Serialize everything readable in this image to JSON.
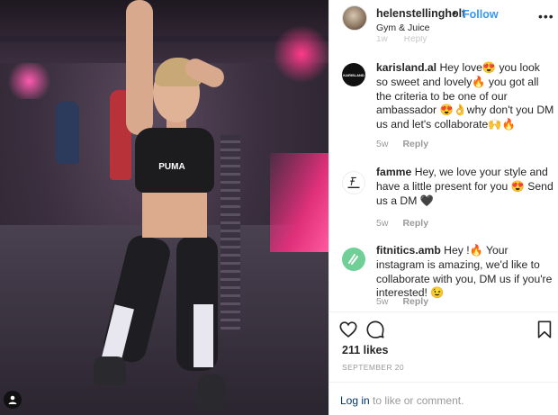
{
  "post": {
    "username": "helenstellingholt",
    "separator": "•",
    "follow_label": "Follow",
    "location": "Gym & Juice",
    "more_label": "•••",
    "photo_logo": "PUMA"
  },
  "peek": {
    "age": "1w",
    "reply": "Reply"
  },
  "comments": [
    {
      "username": "karisland.al",
      "avatar_text": "KARISLAND",
      "text": "Hey love😍 you look so sweet and lovely🔥 you got all the criteria to be one of our ambassador 😍👌why don't you DM us and let's collaborate🙌🔥",
      "age": "5w",
      "reply": "Reply"
    },
    {
      "username": "famme",
      "avatar_text": "FAMME",
      "text": "Hey, we love your style and have a little present for you 😍 Send us a DM 🖤",
      "age": "5w",
      "reply": "Reply"
    },
    {
      "username": "fitnitics.amb",
      "text": "Hey !🔥 Your instagram is amazing, we'd like to collaborate with you, DM us if you're interested! 😉",
      "age": "5w",
      "reply": "Reply"
    }
  ],
  "likes": "211 likes",
  "date": "SEPTEMBER 20",
  "login": {
    "link": "Log in",
    "rest": " to like or comment."
  },
  "icons": [
    "heart-icon",
    "comment-icon",
    "bookmark-icon",
    "user-tag-icon",
    "more-icon"
  ],
  "colors": {
    "link": "#3897f0",
    "muted": "#999999",
    "text": "#262626"
  }
}
